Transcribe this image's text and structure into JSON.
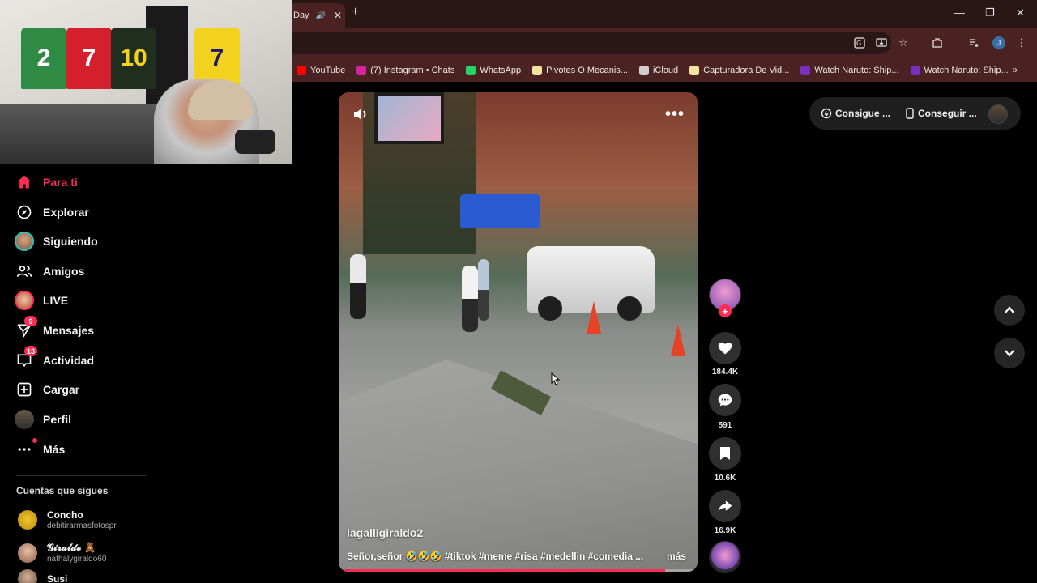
{
  "browser": {
    "tab_title": "Day",
    "new_tab_label": "+",
    "bookmarks": [
      {
        "label": "YouTube",
        "color": "#ff0000"
      },
      {
        "label": "(7) Instagram • Chats",
        "color": "#d6249f"
      },
      {
        "label": "WhatsApp",
        "color": "#25d366"
      },
      {
        "label": "Pivotes O Mecanis...",
        "color": "#f2e3a1"
      },
      {
        "label": "iCloud",
        "color": "#cfcfcf"
      },
      {
        "label": "Capturadora De Vid...",
        "color": "#f2e3a1"
      },
      {
        "label": "Watch Naruto: Ship...",
        "color": "#7b2fbf"
      },
      {
        "label": "Watch Naruto: Ship...",
        "color": "#7b2fbf"
      }
    ],
    "profile_initial": "J"
  },
  "webcam": {
    "jerseys": [
      {
        "number": "2",
        "color": "#2f8a43",
        "text_color": "#ffffff"
      },
      {
        "number": "7",
        "color": "#d3202c",
        "text_color": "#ffffff"
      },
      {
        "number": "10",
        "color": "#1f2e1f",
        "text_color": "#f3d21b"
      },
      {
        "number": "7",
        "color": "#f2d21f",
        "text_color": "#1a1a6a"
      }
    ]
  },
  "sidebar": {
    "nav": [
      {
        "label": "Para ti",
        "icon": "home-icon",
        "active": true
      },
      {
        "label": "Explorar",
        "icon": "compass-icon"
      },
      {
        "label": "Siguiendo",
        "icon": "following-avatar-icon"
      },
      {
        "label": "Amigos",
        "icon": "friends-icon"
      },
      {
        "label": "LIVE",
        "icon": "live-icon"
      },
      {
        "label": "Mensajes",
        "icon": "messages-icon",
        "badge": "9"
      },
      {
        "label": "Actividad",
        "icon": "activity-icon",
        "badge": "13"
      },
      {
        "label": "Cargar",
        "icon": "upload-icon"
      },
      {
        "label": "Perfil",
        "icon": "profile-avatar-icon"
      },
      {
        "label": "Más",
        "icon": "more-icon"
      }
    ],
    "following_title": "Cuentas que sigues",
    "following": [
      {
        "name": "Concho",
        "username": "debitirarmasfotospr"
      },
      {
        "name": "𝓖𝓲𝓻𝓪𝓵𝓭𝓸 🧸",
        "username": "nathalygiraldo60"
      },
      {
        "name": "Susi",
        "username": ""
      }
    ]
  },
  "video": {
    "author": "lagalligiraldo2",
    "caption": "Señor,señor 🤣🤣🤣 #tiktok #meme #risa #medellin #comedia ...",
    "more_label": "más",
    "progress": 0.91
  },
  "actions": {
    "likes": "184.4K",
    "comments": "591",
    "saves": "10.6K",
    "shares": "16.9K"
  },
  "top_pills": {
    "coins_label": "Consigue ...",
    "app_label": "Conseguir ..."
  },
  "colors": {
    "accent": "#fe2c55",
    "chrome_dark": "#2b1616",
    "chrome_light": "#4a2222"
  }
}
